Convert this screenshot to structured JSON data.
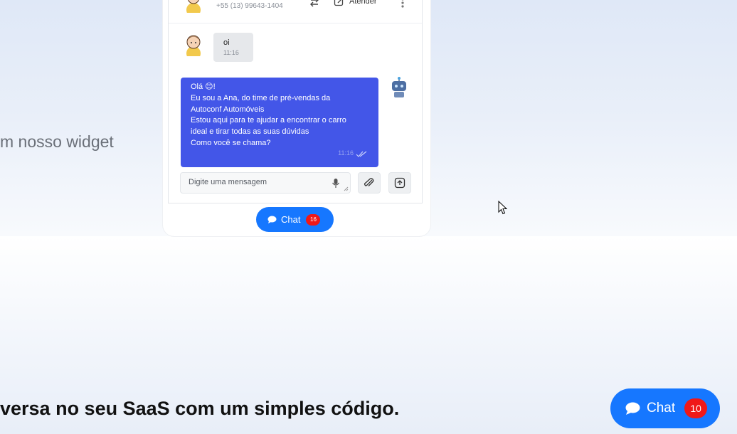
{
  "hero": {
    "text": "m nosso widget"
  },
  "bottom": {
    "text": "versa no seu SaaS com um simples código."
  },
  "chat_header": {
    "phone": "+55 (13) 99643-1404",
    "atender_label": "Atender"
  },
  "messages": {
    "incoming": {
      "text": "oi",
      "time": "11:16"
    },
    "outgoing": {
      "lines": [
        "Olá 😊!",
        "Eu sou a Ana, do time de pré-vendas da",
        "Autoconf Automóveis",
        "Estou aqui para te ajudar a encontrar o carro",
        "ideal e tirar todas as suas dúvidas",
        "Como você se chama?"
      ],
      "time": "11:16"
    }
  },
  "composer": {
    "placeholder": "Digite uma mensagem"
  },
  "chat_pill_small": {
    "label": "Chat",
    "badge": "16"
  },
  "chat_pill_large": {
    "label": "Chat",
    "badge": "10"
  },
  "colors": {
    "accent": "#1677ff",
    "bubble": "#4356e8",
    "badge": "#f01818"
  },
  "icons": [
    "user-avatar-icon",
    "transfer-icon",
    "edit-icon",
    "kebab-icon",
    "bot-avatar-icon",
    "double-check-icon",
    "mic-icon",
    "paperclip-icon",
    "attach-file-icon",
    "chat-bubble-icon",
    "cursor-icon"
  ]
}
